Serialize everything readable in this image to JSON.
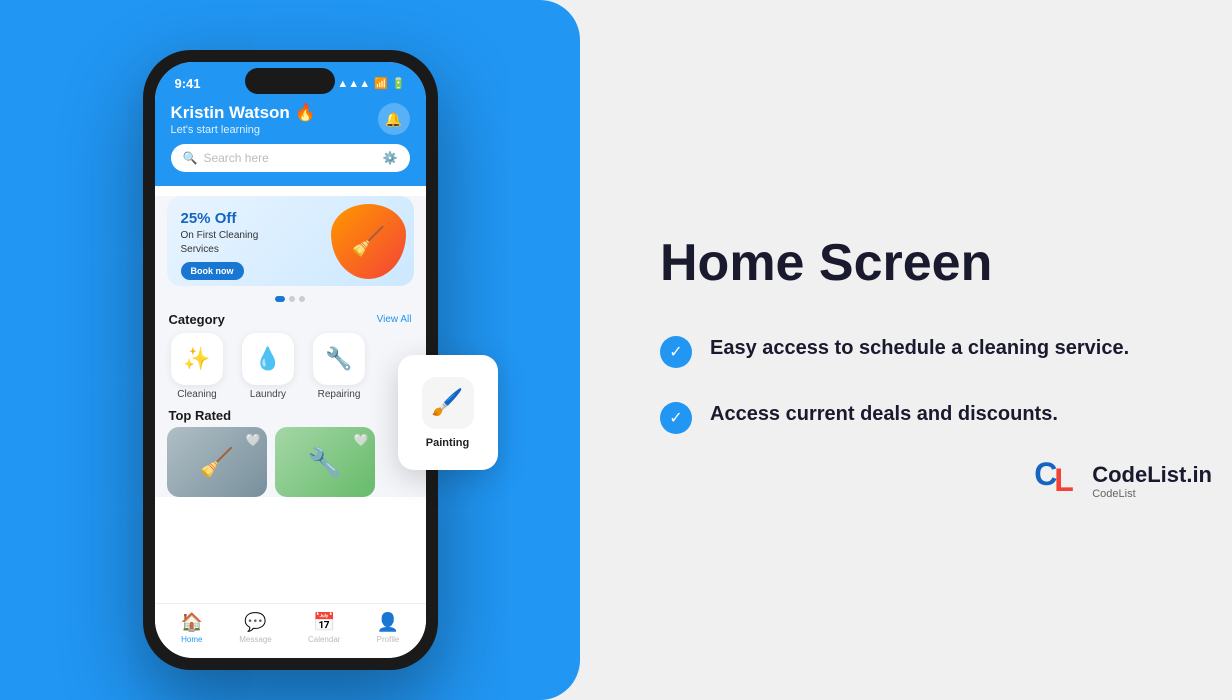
{
  "left_panel": {
    "background_color": "#2196f3"
  },
  "phone": {
    "status_bar": {
      "time": "9:41",
      "signal_icon": "▲▲▲",
      "wifi_icon": "wifi",
      "battery_icon": "▮▮▮"
    },
    "header": {
      "user_name": "Kristin Watson 🔥",
      "user_subtitle": "Let's start learning",
      "search_placeholder": "Search here",
      "bell_icon": "🔔"
    },
    "banner": {
      "discount": "25% Off",
      "text": "On First Cleaning\nServices",
      "button_label": "Book now",
      "image_emoji": "🧹"
    },
    "category": {
      "title": "Category",
      "view_all": "View All",
      "items": [
        {
          "label": "Cleaning",
          "icon": "✨"
        },
        {
          "label": "Laundry",
          "icon": "💧"
        },
        {
          "label": "Repairing",
          "icon": "🔧"
        }
      ]
    },
    "painting_card": {
      "label": "Painting",
      "icon": "🖌️"
    },
    "top_rated": {
      "title": "Top Rated"
    },
    "bottom_nav": {
      "items": [
        {
          "label": "Home",
          "icon": "🏠",
          "active": true
        },
        {
          "label": "Message",
          "icon": "💬",
          "active": false
        },
        {
          "label": "Calendar",
          "icon": "📅",
          "active": false
        },
        {
          "label": "Profile",
          "icon": "👤",
          "active": false
        }
      ]
    }
  },
  "right_panel": {
    "title": "Home Screen",
    "features": [
      {
        "text": "Easy access to schedule a cleaning service."
      },
      {
        "text": "Access current deals and discounts."
      }
    ],
    "check_icon": "✓"
  },
  "watermark": {
    "logo_c": "C",
    "logo_l": "L",
    "name": "CodeList.in",
    "sub": "CodeList"
  }
}
